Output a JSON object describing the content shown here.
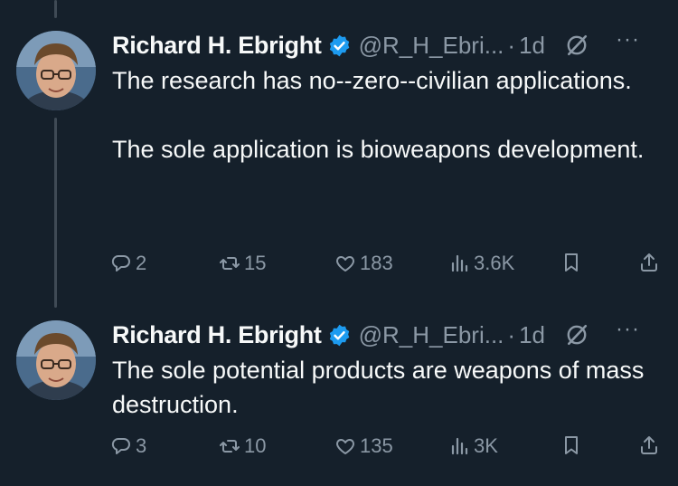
{
  "tweets": [
    {
      "author_name": "Richard H. Ebright",
      "handle": "@R_H_Ebri...",
      "separator": "·",
      "time": "1d",
      "more_label": "···",
      "paragraphs": [
        "The research has no--zero--civilian applications.",
        "The sole application is bioweapons development."
      ],
      "stats": {
        "replies": "2",
        "reposts": "15",
        "likes": "183",
        "views": "3.6K"
      }
    },
    {
      "author_name": "Richard H. Ebright",
      "handle": "@R_H_Ebri...",
      "separator": "·",
      "time": "1d",
      "more_label": "···",
      "paragraphs": [
        "The sole potential products are weapons of mass destruction."
      ],
      "stats": {
        "replies": "3",
        "reposts": "10",
        "likes": "135",
        "views": "3K"
      }
    }
  ],
  "colors": {
    "background": "#15202b",
    "text": "#f7f9f9",
    "secondary": "#8b98a5",
    "verified": "#1d9bf0",
    "thread_line": "#3f4a55"
  },
  "icons": [
    "verified-badge-icon",
    "grok-icon",
    "more-icon",
    "reply-icon",
    "repost-icon",
    "like-icon",
    "views-icon",
    "bookmark-icon",
    "share-icon"
  ]
}
